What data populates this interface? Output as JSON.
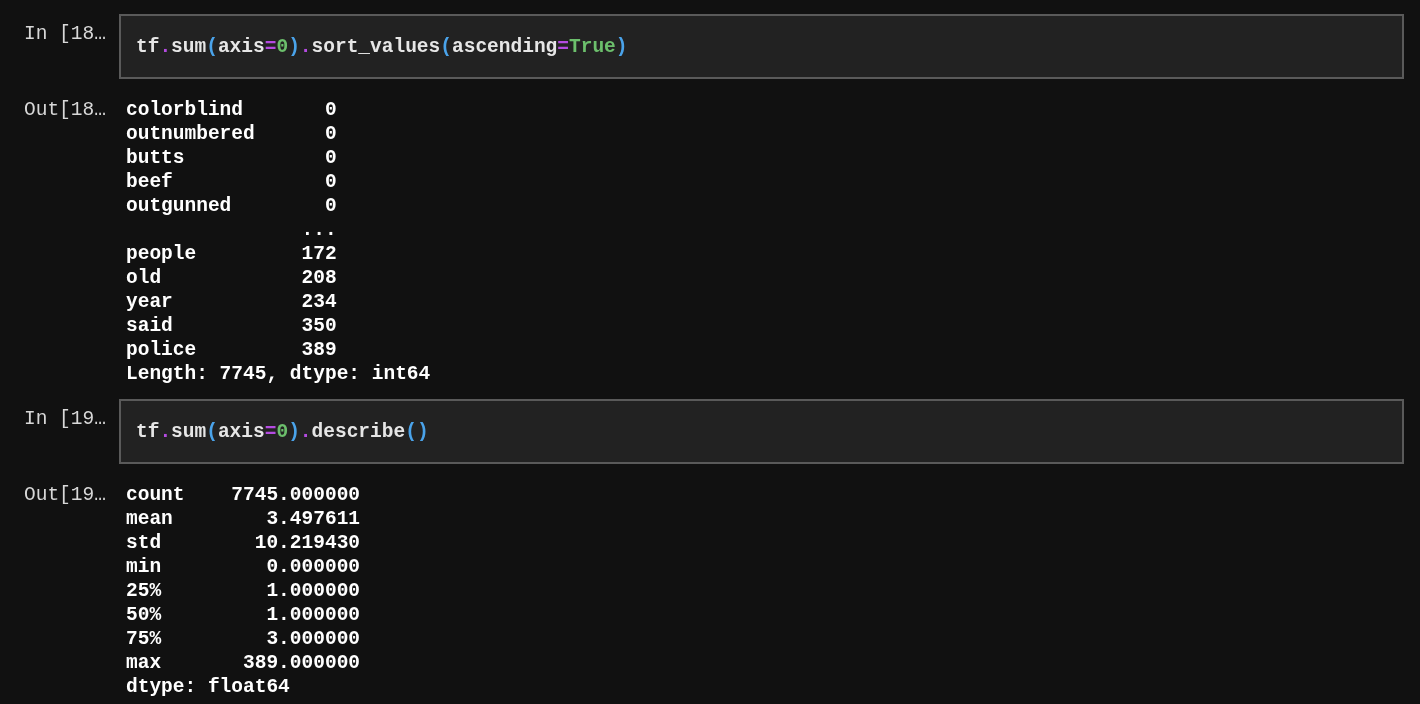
{
  "cells": [
    {
      "in_prompt": "In [18…",
      "code": [
        {
          "kind": "name",
          "text": "tf"
        },
        {
          "kind": "op",
          "text": "."
        },
        {
          "kind": "name",
          "text": "sum"
        },
        {
          "kind": "paren",
          "text": "("
        },
        {
          "kind": "name",
          "text": "axis"
        },
        {
          "kind": "op",
          "text": "="
        },
        {
          "kind": "number",
          "text": "0"
        },
        {
          "kind": "paren",
          "text": ")"
        },
        {
          "kind": "op",
          "text": "."
        },
        {
          "kind": "name",
          "text": "sort_values"
        },
        {
          "kind": "paren",
          "text": "("
        },
        {
          "kind": "name",
          "text": "ascending"
        },
        {
          "kind": "op",
          "text": "="
        },
        {
          "kind": "keyword",
          "text": "True"
        },
        {
          "kind": "paren",
          "text": ")"
        }
      ],
      "out_prompt": "Out[18…",
      "output": [
        "colorblind       0",
        "outnumbered      0",
        "butts            0",
        "beef             0",
        "outgunned        0",
        "               ...",
        "people         172",
        "old            208",
        "year           234",
        "said           350",
        "police         389",
        "Length: 7745, dtype: int64"
      ]
    },
    {
      "in_prompt": "In [19…",
      "code": [
        {
          "kind": "name",
          "text": "tf"
        },
        {
          "kind": "op",
          "text": "."
        },
        {
          "kind": "name",
          "text": "sum"
        },
        {
          "kind": "paren",
          "text": "("
        },
        {
          "kind": "name",
          "text": "axis"
        },
        {
          "kind": "op",
          "text": "="
        },
        {
          "kind": "number",
          "text": "0"
        },
        {
          "kind": "paren",
          "text": ")"
        },
        {
          "kind": "op",
          "text": "."
        },
        {
          "kind": "name",
          "text": "describe"
        },
        {
          "kind": "paren",
          "text": "("
        },
        {
          "kind": "paren",
          "text": ")"
        }
      ],
      "out_prompt": "Out[19…",
      "output": [
        "count    7745.000000",
        "mean        3.497611",
        "std        10.219430",
        "min         0.000000",
        "25%         1.000000",
        "50%         1.000000",
        "75%         3.000000",
        "max       389.000000",
        "dtype: float64"
      ]
    }
  ]
}
